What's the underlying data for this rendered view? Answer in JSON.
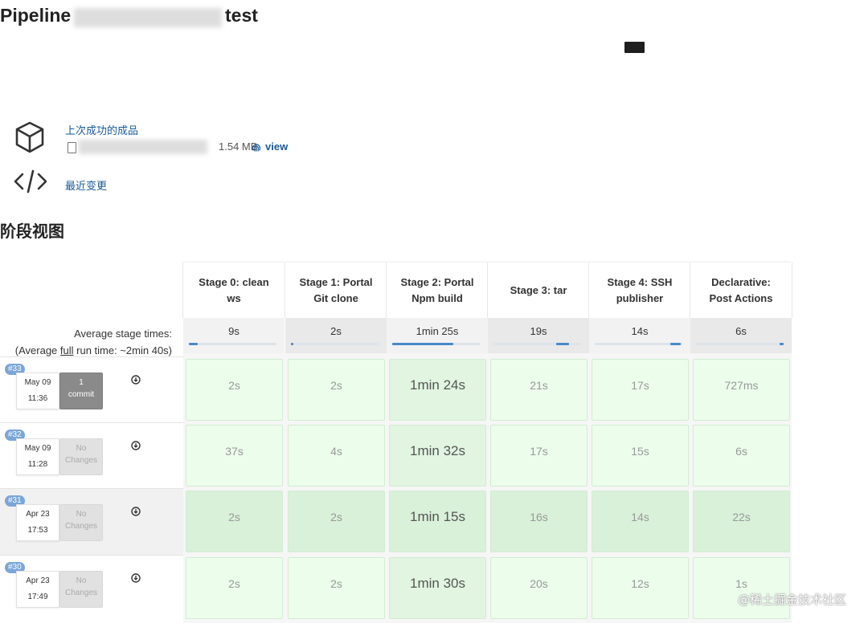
{
  "page": {
    "title_prefix": "Pipeline",
    "title_suffix": "test"
  },
  "artifacts": {
    "title": "上次成功的成品",
    "file_size": "1.54 MB",
    "view_label": "view"
  },
  "changes": {
    "label": "最近变更"
  },
  "stage_view": {
    "section_title": "阶段视图",
    "avg_label_line1": "Average stage times:",
    "avg_label_line2_prefix": "(Average ",
    "avg_label_line2_link": "full",
    "avg_label_line2_suffix": " run time: ~2min 40s)",
    "stages": [
      {
        "line1": "Stage 0: clean",
        "line2": "ws",
        "avg": "9s",
        "avg_fraction": 0.1
      },
      {
        "line1": "Stage 1: Portal",
        "line2": "Git clone",
        "avg": "2s",
        "avg_fraction": 0.02
      },
      {
        "line1": "Stage 2: Portal",
        "line2": "Npm build",
        "avg": "1min 25s",
        "avg_fraction": 0.7
      },
      {
        "line1": "Stage 3: tar",
        "line2": "",
        "avg": "19s",
        "avg_fraction": 0.15
      },
      {
        "line1": "Stage 4: SSH",
        "line2": "publisher",
        "avg": "14s",
        "avg_fraction": 0.12
      },
      {
        "line1": "Declarative:",
        "line2": "Post Actions",
        "avg": "6s",
        "avg_fraction": 0.05
      }
    ],
    "runs": [
      {
        "badge": "#33",
        "date": "May 09",
        "time": "11:36",
        "changes_l1": "1",
        "changes_l2": "commit",
        "has_commit": true,
        "durations": [
          "2s",
          "2s",
          "1min 24s",
          "21s",
          "17s",
          "727ms"
        ]
      },
      {
        "badge": "#32",
        "date": "May 09",
        "time": "11:28",
        "changes_l1": "No",
        "changes_l2": "Changes",
        "has_commit": false,
        "durations": [
          "37s",
          "4s",
          "1min 32s",
          "17s",
          "15s",
          "6s"
        ]
      },
      {
        "badge": "#31",
        "date": "Apr 23",
        "time": "17:53",
        "changes_l1": "No",
        "changes_l2": "Changes",
        "has_commit": false,
        "durations": [
          "2s",
          "2s",
          "1min 15s",
          "16s",
          "14s",
          "22s"
        ]
      },
      {
        "badge": "#30",
        "date": "Apr 23",
        "time": "17:49",
        "changes_l1": "No",
        "changes_l2": "Changes",
        "has_commit": false,
        "durations": [
          "2s",
          "2s",
          "1min 30s",
          "20s",
          "12s",
          "1s"
        ]
      }
    ]
  },
  "icons": {
    "artifact": "package-cube-icon",
    "changes": "code-brackets-icon",
    "fingerprint": "fingerprint-icon",
    "file": "file-icon",
    "download": "download-circle-icon"
  },
  "watermark": "@稀土掘金技术社区"
}
